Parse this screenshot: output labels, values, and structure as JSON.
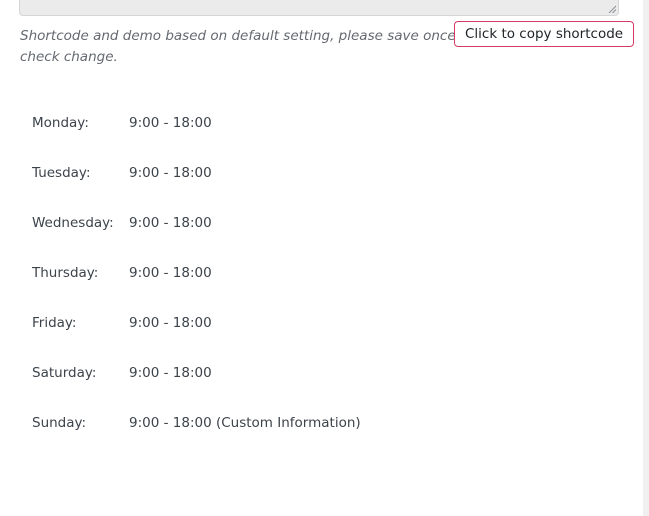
{
  "shortcode": {
    "note": "Shortcode and demo based on default setting, please save once to check change.",
    "copy_button": "Click to copy shortcode"
  },
  "opening_hours": [
    {
      "day": "Monday:",
      "time": "9:00 - 18:00"
    },
    {
      "day": "Tuesday:",
      "time": "9:00 - 18:00"
    },
    {
      "day": "Wednesday:",
      "time": "9:00 - 18:00"
    },
    {
      "day": "Thursday:",
      "time": "9:00 - 18:00"
    },
    {
      "day": "Friday:",
      "time": "9:00 - 18:00"
    },
    {
      "day": "Saturday:",
      "time": "9:00 - 18:00"
    },
    {
      "day": "Sunday:",
      "time": "9:00 - 18:00 (Custom Information)"
    }
  ]
}
